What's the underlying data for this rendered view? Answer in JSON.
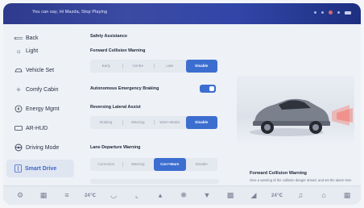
{
  "status_bar": {
    "message": "You can say, Hi Mazda, Stop Playing"
  },
  "sidebar": {
    "items": [
      {
        "label": "Back",
        "icon": "back-arrow-icon"
      },
      {
        "label": "Light",
        "icon": "light-icon"
      },
      {
        "label": "Vehicle Set",
        "icon": "car-icon"
      },
      {
        "label": "Comfy Cabin",
        "icon": "seat-icon"
      },
      {
        "label": "Energy Mgmt",
        "icon": "energy-icon"
      },
      {
        "label": "AR-HUD",
        "icon": "hud-icon"
      },
      {
        "label": "Driving Mode",
        "icon": "steering-wheel-icon"
      },
      {
        "label": "Smart Drive",
        "icon": "smart-drive-icon",
        "active": true
      }
    ]
  },
  "panel": {
    "title": "Safety Assistance",
    "fcw": {
      "label": "Forward Collision Warning",
      "options": [
        "Early",
        "Centre",
        "Late",
        "Disable"
      ],
      "selected": "Disable"
    },
    "aeb": {
      "label": "Autonomous Emergency Braking",
      "enabled": true
    },
    "rla": {
      "label": "Reversing Lateral Assist",
      "options": [
        "Braking",
        "Warning",
        "Warn+Brake",
        "Disable"
      ],
      "selected": "Disable"
    },
    "ldw": {
      "label": "Lane Departure Warning",
      "options": [
        "Correction",
        "Warning",
        "Corr+Warn",
        "Disable"
      ],
      "selected": "Corr+Warn"
    }
  },
  "info": {
    "title": "Forward Collision Warning",
    "description": "Give a warning of the collision danger ahead, and set the alarm time"
  },
  "dock": {
    "left_temp": "24℃",
    "right_temp": "24℃"
  },
  "colors": {
    "accent": "#3c6ed0",
    "status_bar": "#3246a8"
  }
}
